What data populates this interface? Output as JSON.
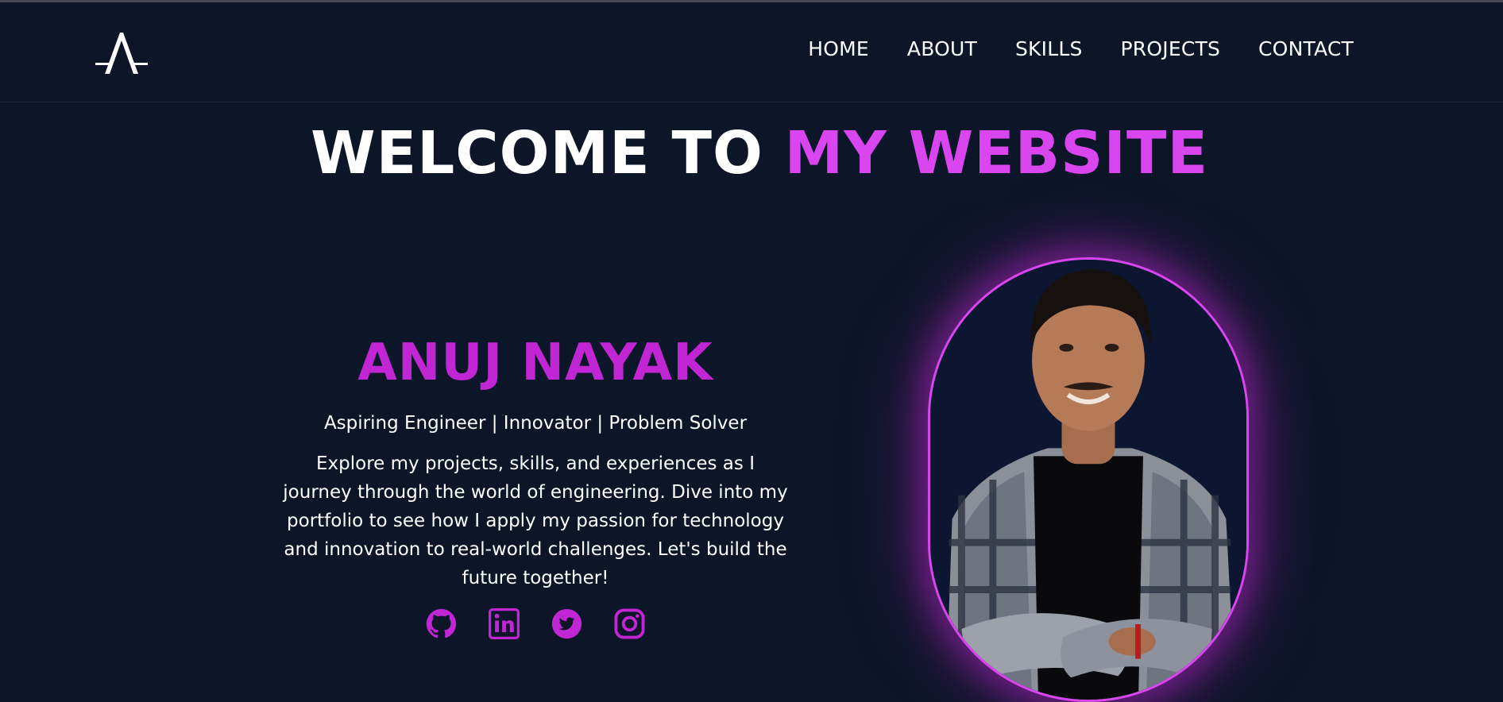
{
  "nav": {
    "logo_icon": "stylized-a-logo",
    "items": [
      "HOME",
      "ABOUT",
      "SKILLS",
      "PROJECTS",
      "CONTACT"
    ]
  },
  "hero": {
    "title_plain": "WELCOME TO ",
    "title_accent": "MY WEBSITE",
    "name": "ANUJ NAYAK",
    "tagline": "Aspiring Engineer | Innovator | Problem Solver",
    "intro": "Explore my projects, skills, and experiences as I journey through the world of engineering. Dive into my portfolio to see how I apply my passion for technology and innovation to real-world challenges. Let's build the future together!"
  },
  "socials": [
    "github-icon",
    "linkedin-icon",
    "twitter-icon",
    "instagram-icon"
  ],
  "profile_image": "portrait-photo",
  "colors": {
    "background": "#0d1528",
    "accent": "#d946ef",
    "accent_dark": "#c026d3",
    "text": "#ffffff"
  }
}
